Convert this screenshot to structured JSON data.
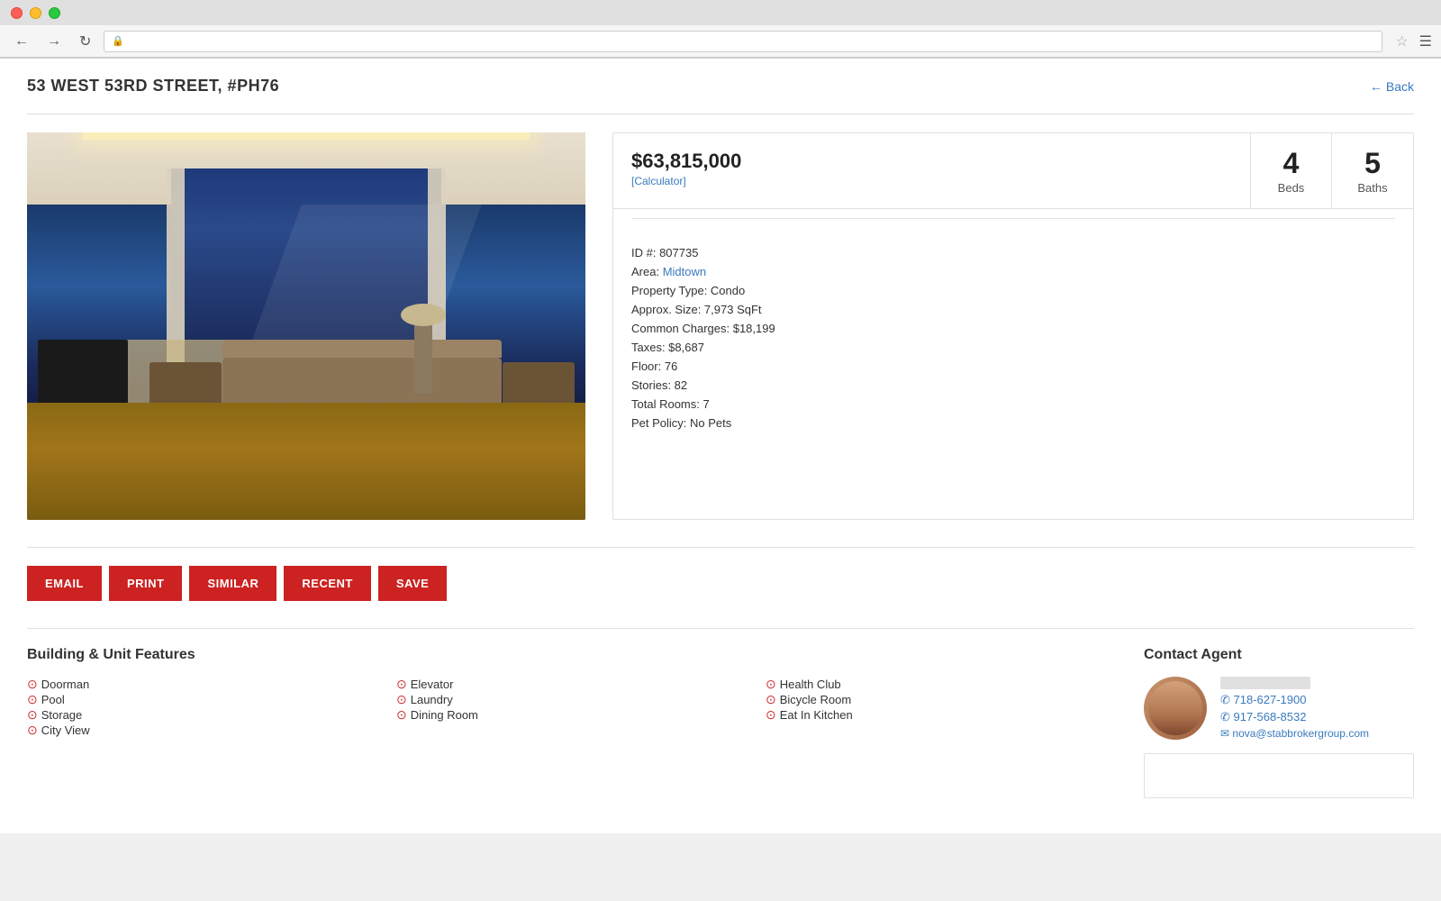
{
  "browser": {
    "back_label": "←",
    "forward_label": "→",
    "refresh_label": "↻",
    "url": ""
  },
  "header": {
    "address": "53 WEST 53RD STREET, #PH76",
    "back_link": "← Back"
  },
  "property": {
    "price": "$63,815,000",
    "calculator_label": "[Calculator]",
    "beds_number": "4",
    "beds_label": "Beds",
    "baths_number": "5",
    "baths_label": "Baths",
    "id": "ID #: 807735",
    "area_label": "Area:",
    "area_value": "Midtown",
    "property_type": "Property Type: Condo",
    "approx_size": "Approx. Size: 7,973 SqFt",
    "common_charges": "Common Charges: $18,199",
    "taxes": "Taxes: $8,687",
    "floor": "Floor: 76",
    "stories": "Stories: 82",
    "total_rooms": "Total Rooms: 7",
    "pet_policy": "Pet Policy: No Pets"
  },
  "actions": {
    "email": "EMAIL",
    "print": "PRINT",
    "similar": "SIMILAR",
    "recent": "RECENT",
    "save": "SAVE"
  },
  "features": {
    "title": "Building & Unit Features",
    "column1": [
      "Doorman",
      "Pool",
      "Storage",
      "City View"
    ],
    "column2": [
      "Elevator",
      "Laundry",
      "Dining Room"
    ],
    "column3": [
      "Health Club",
      "Bicycle Room",
      "Eat In Kitchen"
    ]
  },
  "contact": {
    "title": "Contact Agent",
    "agent_name": "",
    "agent_phone1": "✆ 718-627-1900",
    "agent_phone2": "✆ 917-568-8532",
    "agent_email": "✉ nova@stabbrokergroup.com"
  }
}
